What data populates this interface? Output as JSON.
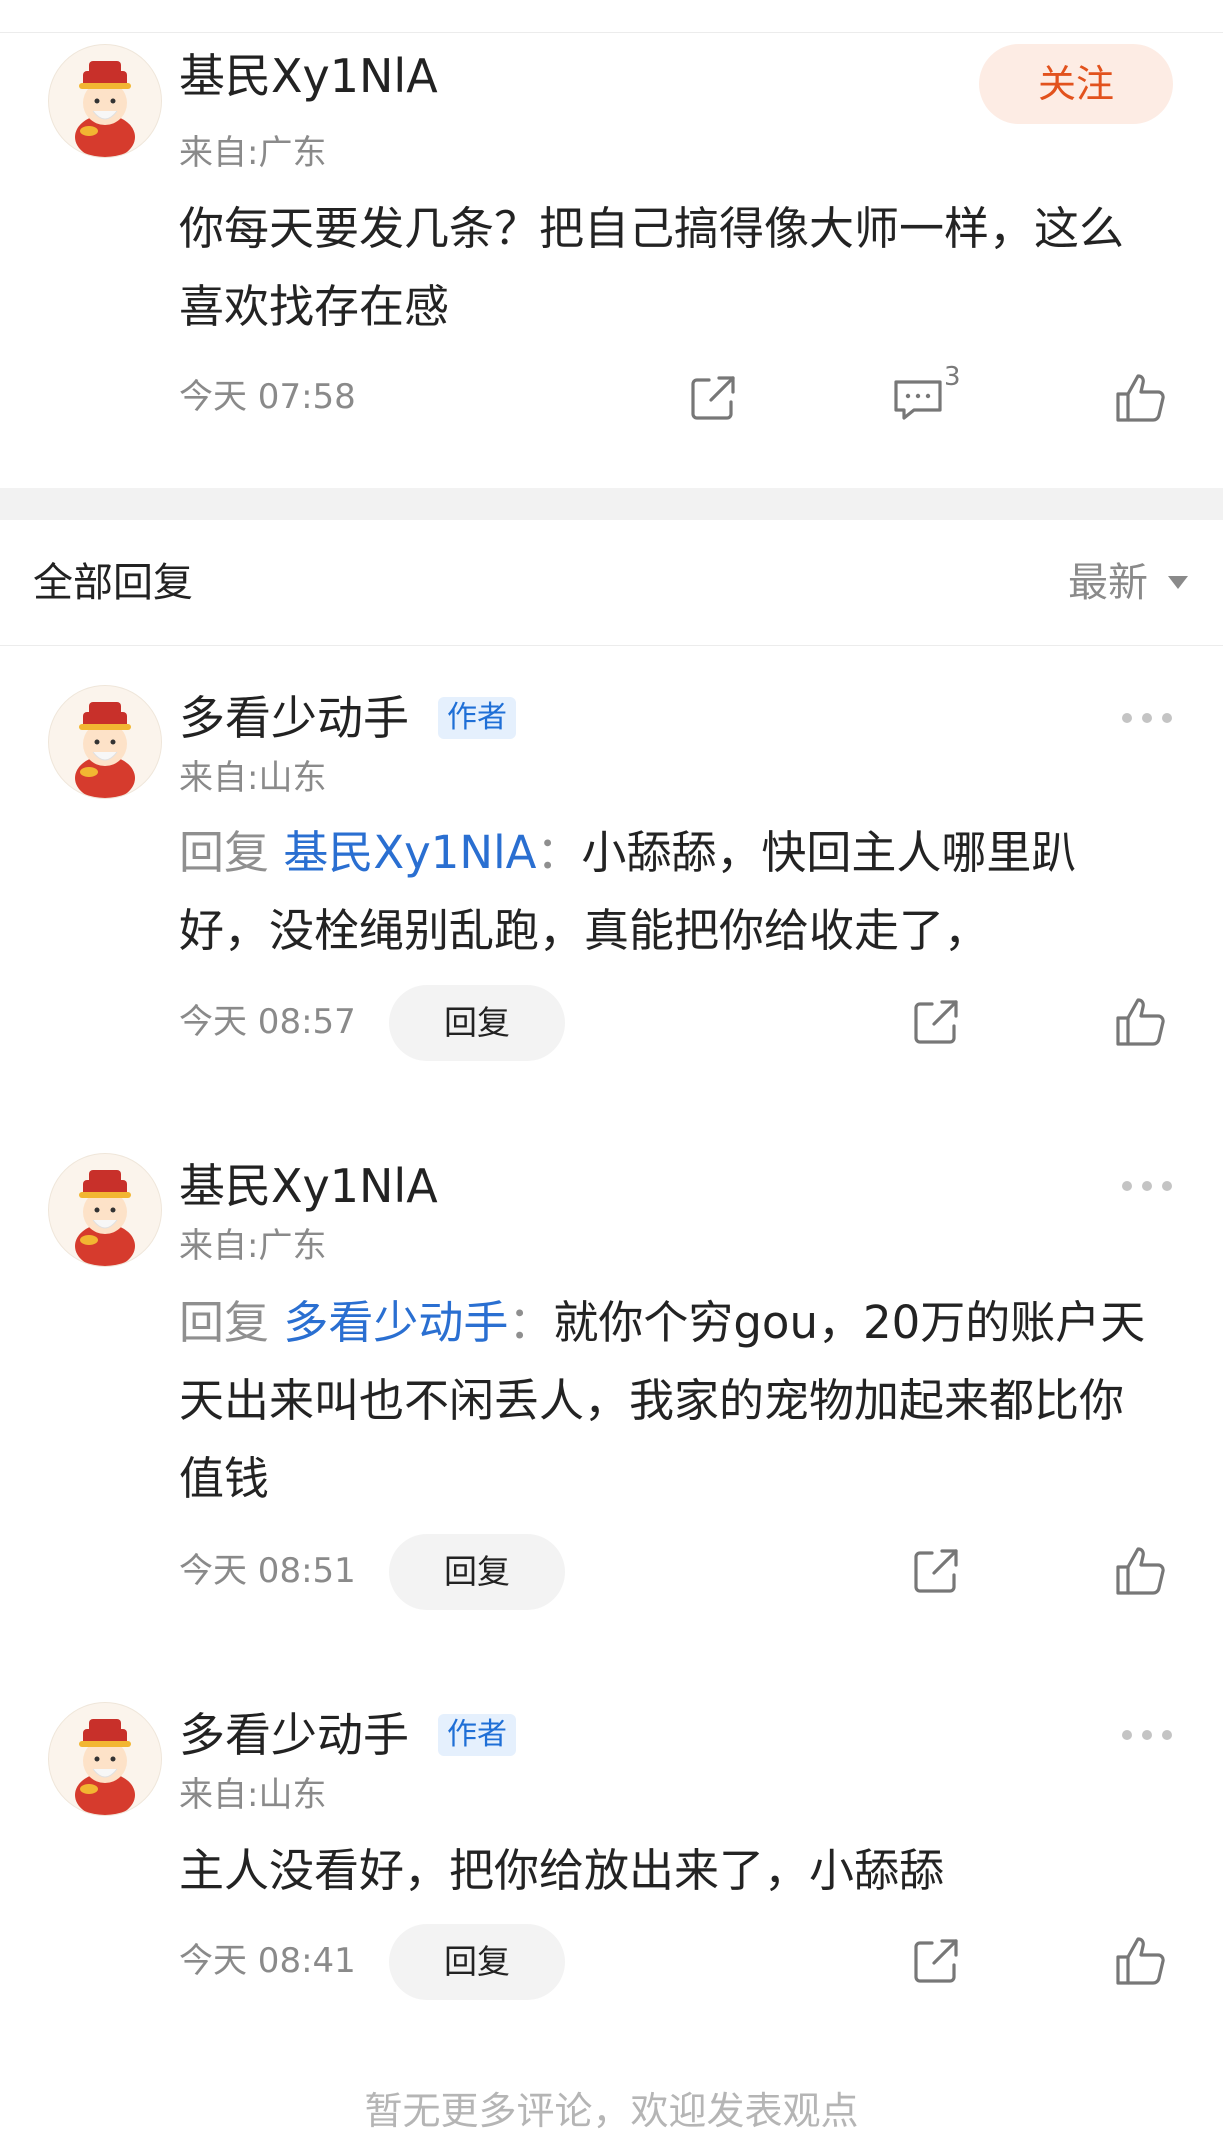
{
  "post": {
    "user": "基民Xy1NlA",
    "location": "来自:广东",
    "follow_label": "关注",
    "content": "你每天要发几条？把自己搞得像大师一样，这么喜欢找存在感",
    "time": "今天 07:58",
    "comment_count": "3"
  },
  "section": {
    "title": "全部回复",
    "sort_label": "最新"
  },
  "replies": [
    {
      "user": "多看少动手",
      "badge": "作者",
      "location": "来自:山东",
      "reply_label": "回复 ",
      "reply_to": "基民Xy1NlA",
      "separator": "：",
      "text": "小舔舔，快回主人哪里趴好，没栓绳别乱跑，真能把你给收走了，",
      "time": "今天 08:57",
      "reply_button": "回复"
    },
    {
      "user": "基民Xy1NlA",
      "location": "来自:广东",
      "reply_label": "回复 ",
      "reply_to": "多看少动手",
      "separator": "：",
      "text": "就你个穷gou，20万的账户天天出来叫也不闲丢人，我家的宠物加起来都比你值钱",
      "time": "今天 08:51",
      "reply_button": "回复"
    },
    {
      "user": "多看少动手",
      "badge": "作者",
      "location": "来自:山东",
      "text": "主人没看好，把你给放出来了，小舔舔",
      "time": "今天 08:41",
      "reply_button": "回复"
    }
  ],
  "footer": {
    "hint": "暂无更多评论，欢迎发表观点"
  },
  "icons": {
    "share": "share-icon",
    "comment": "comment-icon",
    "like": "thumbs-up-icon",
    "more": "more-dots-icon",
    "avatar": "caishen-avatar"
  },
  "colors": {
    "follow_bg": "#fdece4",
    "follow_text": "#e2521d",
    "link_blue": "#2a6fd1",
    "badge_bg": "#e5f0fd"
  }
}
